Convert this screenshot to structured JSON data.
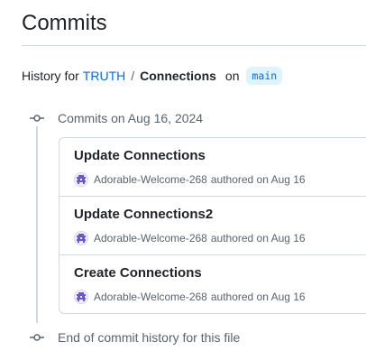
{
  "page": {
    "title": "Commits"
  },
  "breadcrumb": {
    "prefix": "History for",
    "repo": "TRUTH",
    "separator": "/",
    "file": "Connections",
    "on": "on",
    "branch": "main"
  },
  "timeline": {
    "group_header": "Commits on Aug 16, 2024",
    "end_label": "End of commit history for this file"
  },
  "commits": [
    {
      "title": "Update Connections",
      "author": "Adorable-Welcome-268",
      "authored_text": "authored on Aug 16"
    },
    {
      "title": "Update Connections2",
      "author": "Adorable-Welcome-268",
      "authored_text": "authored on Aug 16"
    },
    {
      "title": "Create Connections",
      "author": "Adorable-Welcome-268",
      "authored_text": "authored on Aug 16"
    }
  ],
  "colors": {
    "link": "#0969da",
    "muted": "#59636e",
    "border": "#d1d9e0",
    "branch_bg": "#ddf4ff",
    "avatar": "#6e56cf"
  },
  "icons": {
    "timeline_node": "git-commit-icon",
    "avatar": "identicon-avatar"
  }
}
